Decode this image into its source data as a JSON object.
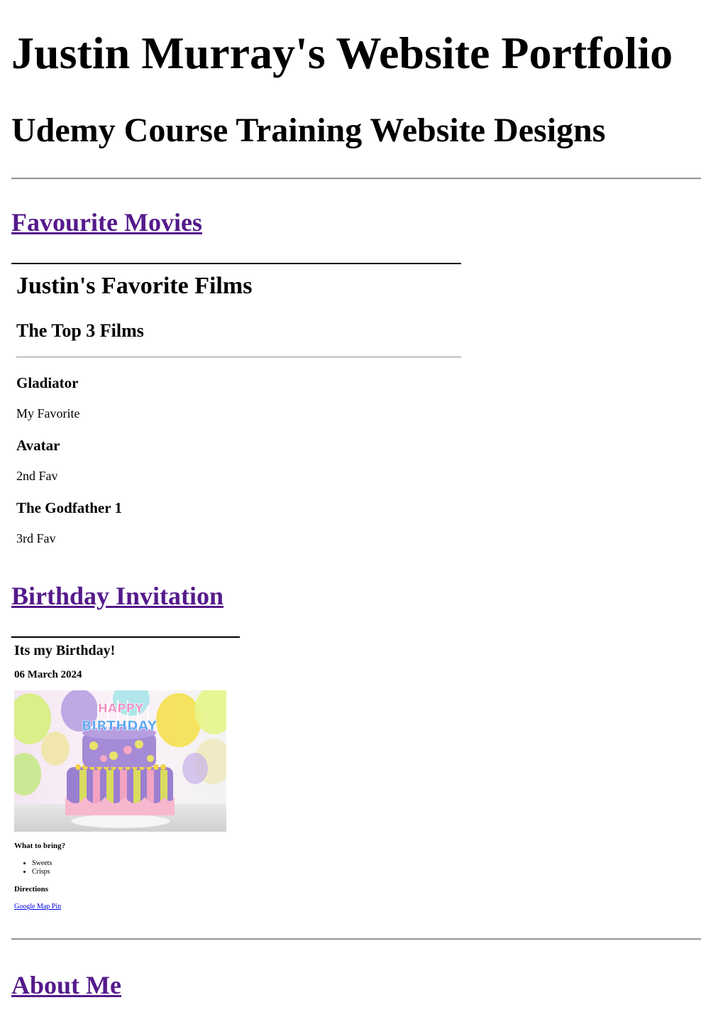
{
  "header": {
    "title": "Justin Murray's Website Portfolio",
    "subtitle": "Udemy Course Training Website Designs"
  },
  "sections": {
    "movies_link": "Favourite Movies",
    "birthday_link": "Birthday Invitation",
    "about_link": "About Me"
  },
  "movies": {
    "heading": "Justin's Favorite Films",
    "subheading": "The Top 3 Films",
    "films": [
      {
        "title": "Gladiator",
        "note": "My Favorite"
      },
      {
        "title": "Avatar",
        "note": "2nd Fav"
      },
      {
        "title": "The Godfather 1",
        "note": "3rd Fav"
      }
    ]
  },
  "birthday": {
    "heading": "Its my Birthday!",
    "date": "06 March 2024",
    "cake_topper": "HAPPY BIRTHDAY",
    "bring_heading": "What to bring?",
    "bring_items": [
      "Sweets",
      "Crisps"
    ],
    "directions_heading": "Directions",
    "map_link": "Google Map Pin"
  },
  "colors": {
    "visited_link": "#551a8b",
    "link": "#0000ee",
    "rule": "#9a9a9a"
  }
}
